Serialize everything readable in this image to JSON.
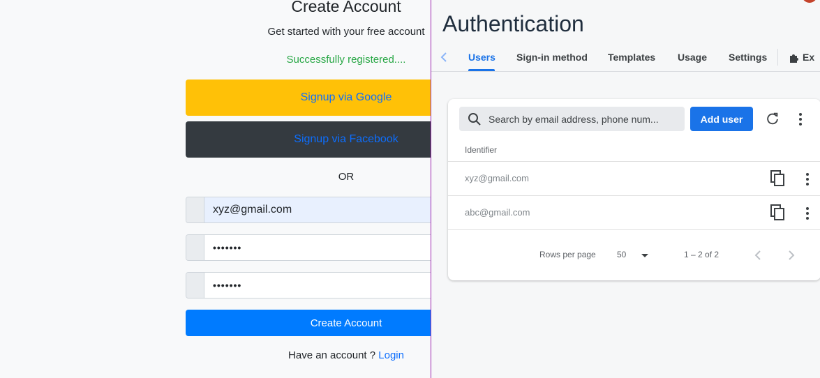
{
  "signup": {
    "title": "Create Account",
    "subtitle": "Get started with your free account",
    "success_message": "Successfully registered....",
    "google_button": "Signup via Google",
    "facebook_button": "Signup via Facebook",
    "or_text": "OR",
    "email_value": "xyz@gmail.com",
    "password_value": "•••••••",
    "confirm_password_value": "•••••••",
    "create_button": "Create Account",
    "have_account_text": "Have an account ?",
    "login_link": "Login"
  },
  "auth": {
    "title": "Authentication",
    "tabs": [
      {
        "label": "Users",
        "active": true
      },
      {
        "label": "Sign-in method"
      },
      {
        "label": "Templates"
      },
      {
        "label": "Usage"
      },
      {
        "label": "Settings"
      },
      {
        "label": "Ex"
      }
    ],
    "search_placeholder": "Search by email address, phone num...",
    "add_user_button": "Add user",
    "column_identifier": "Identifier",
    "users": [
      {
        "identifier": "xyz@gmail.com"
      },
      {
        "identifier": "abc@gmail.com"
      }
    ],
    "rows_per_page_label": "Rows per page",
    "rows_per_page_value": "50",
    "range_text": "1 – 2 of 2"
  },
  "colors": {
    "accent": "#1a73e8",
    "google_button": "#ffc107",
    "facebook_button": "#343a40",
    "success_text": "#28a745",
    "create_button": "#007bff"
  },
  "icons": [
    "search-icon",
    "refresh-icon",
    "more-vert-icon",
    "copy-icon",
    "chevron-left-icon",
    "chevron-right-icon",
    "dropdown-arrow-icon",
    "extensions-icon"
  ]
}
